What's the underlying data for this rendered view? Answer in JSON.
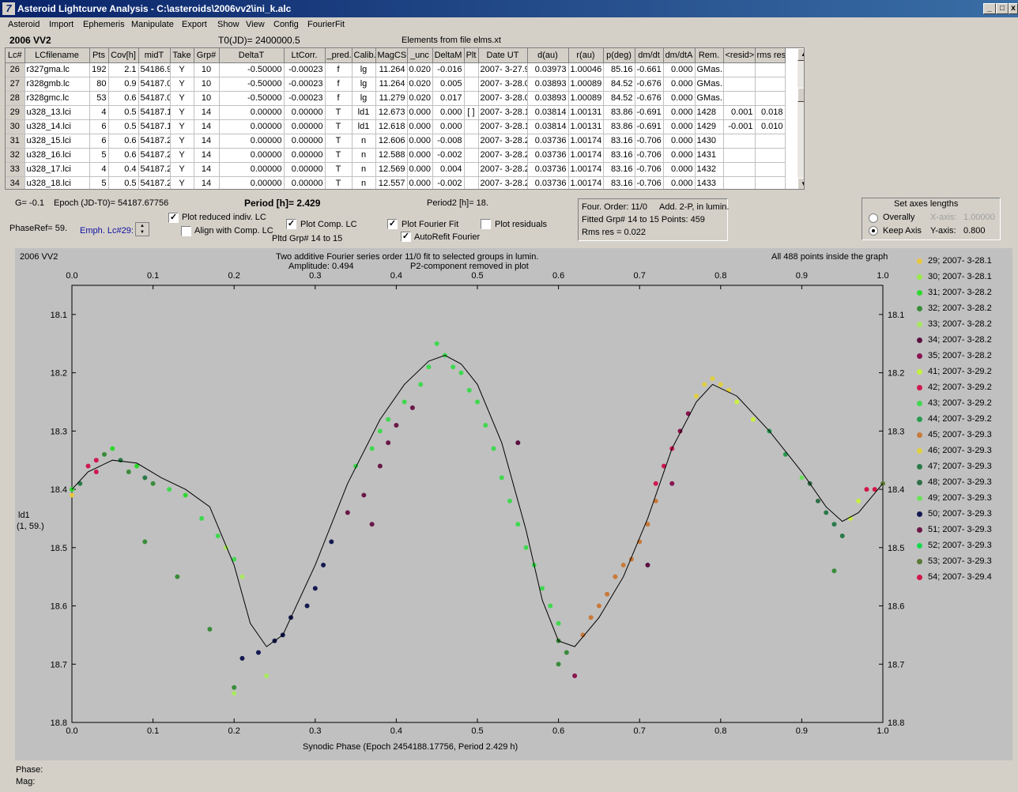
{
  "window": {
    "title": "Asteroid Lightcurve Analysis - C:\\asteroids\\2006vv2\\ini_k.alc",
    "controls": [
      "_",
      "□",
      "x"
    ]
  },
  "menu": [
    "Asteroid",
    "Import",
    "Ephemeris",
    "Manipulate",
    "Export",
    "Show",
    "View",
    "Config",
    "FourierFit"
  ],
  "header": {
    "object": "2006 VV2",
    "t0": "T0(JD)= 2400000.5",
    "elements": "Elements from file elms.xt"
  },
  "table": {
    "columns": [
      "Lc#",
      "LCfilename",
      "Pts",
      "Cov[h]",
      "midT",
      "Take",
      "Grp#",
      "DeltaT",
      "LtCorr.",
      "_pred.",
      "Calib.",
      "MagCS",
      "_unc",
      "DeltaM",
      "Plt",
      "Date UT",
      "d(au)",
      "r(au)",
      "p(deg)",
      "dm/dt",
      "dm/dtA",
      "Rem.",
      "<resid>",
      "rms res"
    ],
    "rows": [
      [
        "26",
        "r327gma.lc",
        "192",
        "2.1",
        "54186.9",
        "Y",
        "10",
        "-0.50000",
        "-0.00023",
        "f",
        "lg",
        "11.264",
        "0.020",
        "-0.016",
        "",
        "2007- 3-27.9",
        "0.03973",
        "1.00046",
        "85.16",
        "-0.661",
        "0.000",
        "GMas..",
        "",
        ""
      ],
      [
        "27",
        "r328gmb.lc",
        "80",
        "0.9",
        "54187.0",
        "Y",
        "10",
        "-0.50000",
        "-0.00023",
        "f",
        "lg",
        "11.264",
        "0.020",
        "0.005",
        "",
        "2007- 3-28.0",
        "0.03893",
        "1.00089",
        "84.52",
        "-0.676",
        "0.000",
        "GMas..",
        "",
        ""
      ],
      [
        "28",
        "r328gmc.lc",
        "53",
        "0.6",
        "54187.0",
        "Y",
        "10",
        "-0.50000",
        "-0.00023",
        "f",
        "lg",
        "11.279",
        "0.020",
        "0.017",
        "",
        "2007- 3-28.0",
        "0.03893",
        "1.00089",
        "84.52",
        "-0.676",
        "0.000",
        "GMas..",
        "",
        ""
      ],
      [
        "29",
        "u328_13.lci",
        "4",
        "0.5",
        "54187.1",
        "Y",
        "14",
        "0.00000",
        "0.00000",
        "T",
        "ld1",
        "12.673",
        "0.000",
        "0.000",
        "[ ]",
        "2007- 3-28.1",
        "0.03814",
        "1.00131",
        "83.86",
        "-0.691",
        "0.000",
        "1428",
        "0.001",
        "0.018"
      ],
      [
        "30",
        "u328_14.lci",
        "6",
        "0.5",
        "54187.1",
        "Y",
        "14",
        "0.00000",
        "0.00000",
        "T",
        "ld1",
        "12.618",
        "0.000",
        "0.000",
        "",
        "2007- 3-28.1",
        "0.03814",
        "1.00131",
        "83.86",
        "-0.691",
        "0.000",
        "1429",
        "-0.001",
        "0.010"
      ],
      [
        "31",
        "u328_15.lci",
        "6",
        "0.6",
        "54187.2",
        "Y",
        "14",
        "0.00000",
        "0.00000",
        "T",
        "n",
        "12.606",
        "0.000",
        "-0.008",
        "",
        "2007- 3-28.2",
        "0.03736",
        "1.00174",
        "83.16",
        "-0.706",
        "0.000",
        "1430",
        "",
        ""
      ],
      [
        "32",
        "u328_16.lci",
        "5",
        "0.6",
        "54187.2",
        "Y",
        "14",
        "0.00000",
        "0.00000",
        "T",
        "n",
        "12.588",
        "0.000",
        "-0.002",
        "",
        "2007- 3-28.2",
        "0.03736",
        "1.00174",
        "83.16",
        "-0.706",
        "0.000",
        "1431",
        "",
        ""
      ],
      [
        "33",
        "u328_17.lci",
        "4",
        "0.4",
        "54187.2",
        "Y",
        "14",
        "0.00000",
        "0.00000",
        "T",
        "n",
        "12.569",
        "0.000",
        "0.004",
        "",
        "2007- 3-28.2",
        "0.03736",
        "1.00174",
        "83.16",
        "-0.706",
        "0.000",
        "1432",
        "",
        ""
      ],
      [
        "34",
        "u328_18.lci",
        "5",
        "0.5",
        "54187.2",
        "Y",
        "14",
        "0.00000",
        "0.00000",
        "T",
        "n",
        "12.557",
        "0.000",
        "-0.002",
        "",
        "2007- 3-28.2",
        "0.03736",
        "1.00174",
        "83.16",
        "-0.706",
        "0.000",
        "1433",
        "",
        ""
      ]
    ]
  },
  "info": {
    "g": "G= -0.1",
    "epoch": "Epoch (JD-T0)= 54187.67756",
    "period": "Period [h]= 2.429",
    "period2": "Period2 [h]= 18.",
    "phaseref": "PhaseRef= 59.",
    "emph": "Emph. Lc#29:"
  },
  "checks": {
    "plot_reduced": "Plot reduced indiv. LC",
    "align": "Align with Comp. LC",
    "plot_comp": "Plot Comp. LC",
    "pltd_grp": "Pltd Grp#  14 to   15",
    "plot_fourier": "Plot Fourier Fit",
    "autorefit": "AutoRefit Fourier",
    "plot_resid": "Plot residuals"
  },
  "fourier_info": {
    "line1a": "Four. Order: 11/0",
    "line1b": "Add. 2-P, in lumin.",
    "line2": "Fitted Grp# 14 to 15 Points: 459",
    "line3": "Rms res      = 0.022"
  },
  "axes_panel": {
    "title": "Set axes lengths",
    "overally": "Overally",
    "keep": "Keep Axis",
    "xaxis_label": "X-axis:",
    "xaxis_val": "1.00000",
    "yaxis_label": "Y-axis:",
    "yaxis_val": "0.800"
  },
  "plot": {
    "name": "2006 VV2",
    "title1": "Two additive Fourier series order 11/0 fit to selected groups in lumin.",
    "amp": "Amplitude: 0.494",
    "p2": "P2-component removed in plot",
    "inside": "All 488 points inside the graph",
    "ylab1": "ld1",
    "ylab2": "(1, 59.)",
    "xlabel": "Synodic Phase (Epoch 2454188.17756, Period 2.429 h)"
  },
  "status": {
    "phase": "Phase:",
    "mag": "Mag:"
  },
  "chart_data": {
    "type": "scatter",
    "xlabel": "Synodic Phase (Epoch 2454188.17756, Period 2.429 h)",
    "ylabel": "ld1",
    "xlim": [
      0,
      1
    ],
    "ylim": [
      18.8,
      18.0
    ],
    "xticks": [
      0.0,
      0.1,
      0.2,
      0.3,
      0.4,
      0.5,
      0.6,
      0.7,
      0.8,
      0.9,
      1.0
    ],
    "yticks": [
      18.1,
      18.2,
      18.3,
      18.4,
      18.5,
      18.6,
      18.7,
      18.8
    ],
    "fit_curve": {
      "x": [
        0,
        0.02,
        0.05,
        0.08,
        0.11,
        0.14,
        0.17,
        0.2,
        0.22,
        0.24,
        0.26,
        0.3,
        0.34,
        0.38,
        0.41,
        0.44,
        0.46,
        0.48,
        0.5,
        0.53,
        0.56,
        0.58,
        0.6,
        0.62,
        0.65,
        0.68,
        0.71,
        0.74,
        0.77,
        0.79,
        0.82,
        0.86,
        0.9,
        0.93,
        0.95,
        0.97,
        1.0
      ],
      "y": [
        18.4,
        18.37,
        18.35,
        18.355,
        18.38,
        18.4,
        18.43,
        18.53,
        18.63,
        18.67,
        18.65,
        18.53,
        18.39,
        18.28,
        18.22,
        18.18,
        18.17,
        18.185,
        18.22,
        18.32,
        18.47,
        18.59,
        18.66,
        18.67,
        18.62,
        18.55,
        18.45,
        18.33,
        18.25,
        18.22,
        18.24,
        18.3,
        18.37,
        18.43,
        18.455,
        18.44,
        18.39
      ]
    },
    "series": [
      {
        "name": "29; 2007- 3-28.1",
        "color": "#e8c840"
      },
      {
        "name": "30; 2007- 3-28.1",
        "color": "#9ae84a"
      },
      {
        "name": "31; 2007- 3-28.2",
        "color": "#2ed82e"
      },
      {
        "name": "32; 2007- 3-28.2",
        "color": "#3a8c3a"
      },
      {
        "name": "33; 2007- 3-28.2",
        "color": "#a8e860"
      },
      {
        "name": "34; 2007- 3-28.2",
        "color": "#5a1040"
      },
      {
        "name": "35; 2007- 3-28.2",
        "color": "#8a1450"
      },
      {
        "name": "41; 2007- 3-29.2",
        "color": "#c8f040"
      },
      {
        "name": "42; 2007- 3-29.2",
        "color": "#d01850"
      },
      {
        "name": "43; 2007- 3-29.2",
        "color": "#40d850"
      },
      {
        "name": "44; 2007- 3-29.2",
        "color": "#2a9a50"
      },
      {
        "name": "45; 2007- 3-29.3",
        "color": "#c87a3a"
      },
      {
        "name": "46; 2007- 3-29.3",
        "color": "#e0d040"
      },
      {
        "name": "47; 2007- 3-29.3",
        "color": "#2a7a4a"
      },
      {
        "name": "48; 2007- 3-29.3",
        "color": "#307048"
      },
      {
        "name": "49; 2007- 3-29.3",
        "color": "#70e060"
      },
      {
        "name": "50; 2007- 3-29.3",
        "color": "#141a50"
      },
      {
        "name": "51; 2007- 3-29.3",
        "color": "#6a1848"
      },
      {
        "name": "52; 2007- 3-29.3",
        "color": "#18d850"
      },
      {
        "name": "53; 2007- 3-29.3",
        "color": "#5a7a38"
      },
      {
        "name": "54; 2007- 3-29.4",
        "color": "#d01848"
      }
    ],
    "points": [
      [
        0.0,
        18.4,
        2
      ],
      [
        0.01,
        18.39,
        13
      ],
      [
        0.02,
        18.36,
        8
      ],
      [
        0.03,
        18.35,
        8
      ],
      [
        0.04,
        18.34,
        3
      ],
      [
        0.05,
        18.33,
        2
      ],
      [
        0.06,
        18.35,
        13
      ],
      [
        0.07,
        18.37,
        3
      ],
      [
        0.08,
        18.36,
        2
      ],
      [
        0.09,
        18.38,
        13
      ],
      [
        0.1,
        18.39,
        3
      ],
      [
        0.12,
        18.4,
        9
      ],
      [
        0.14,
        18.41,
        2
      ],
      [
        0.16,
        18.45,
        9
      ],
      [
        0.18,
        18.48,
        9
      ],
      [
        0.19,
        18.5,
        4
      ],
      [
        0.2,
        18.52,
        9
      ],
      [
        0.21,
        18.55,
        4
      ],
      [
        0.0,
        18.41,
        0
      ],
      [
        0.03,
        18.37,
        8
      ],
      [
        0.09,
        18.49,
        3
      ],
      [
        0.13,
        18.55,
        3
      ],
      [
        0.17,
        18.64,
        3
      ],
      [
        0.2,
        18.74,
        3
      ],
      [
        0.2,
        18.75,
        4
      ],
      [
        0.24,
        18.72,
        4
      ],
      [
        0.26,
        18.65,
        16
      ],
      [
        0.21,
        18.69,
        16
      ],
      [
        0.23,
        18.68,
        16
      ],
      [
        0.25,
        18.66,
        16
      ],
      [
        0.27,
        18.62,
        16
      ],
      [
        0.29,
        18.6,
        16
      ],
      [
        0.3,
        18.57,
        16
      ],
      [
        0.31,
        18.53,
        16
      ],
      [
        0.32,
        18.49,
        16
      ],
      [
        0.34,
        18.44,
        17
      ],
      [
        0.36,
        18.41,
        17
      ],
      [
        0.37,
        18.46,
        17
      ],
      [
        0.38,
        18.36,
        17
      ],
      [
        0.39,
        18.32,
        17
      ],
      [
        0.4,
        18.29,
        17
      ],
      [
        0.42,
        18.26,
        17
      ],
      [
        0.35,
        18.36,
        9
      ],
      [
        0.37,
        18.33,
        9
      ],
      [
        0.38,
        18.3,
        9
      ],
      [
        0.39,
        18.28,
        9
      ],
      [
        0.41,
        18.25,
        9
      ],
      [
        0.43,
        18.22,
        9
      ],
      [
        0.44,
        18.19,
        9
      ],
      [
        0.45,
        18.15,
        9
      ],
      [
        0.46,
        18.17,
        9
      ],
      [
        0.47,
        18.19,
        9
      ],
      [
        0.48,
        18.2,
        9
      ],
      [
        0.49,
        18.23,
        9
      ],
      [
        0.5,
        18.25,
        9
      ],
      [
        0.51,
        18.29,
        9
      ],
      [
        0.52,
        18.33,
        9
      ],
      [
        0.53,
        18.38,
        9
      ],
      [
        0.54,
        18.42,
        9
      ],
      [
        0.55,
        18.46,
        9
      ],
      [
        0.56,
        18.5,
        9
      ],
      [
        0.57,
        18.53,
        9
      ],
      [
        0.58,
        18.57,
        9
      ],
      [
        0.59,
        18.6,
        9
      ],
      [
        0.6,
        18.63,
        9
      ],
      [
        0.6,
        18.66,
        3
      ],
      [
        0.61,
        18.68,
        3
      ],
      [
        0.62,
        18.72,
        6
      ],
      [
        0.6,
        18.7,
        3
      ],
      [
        0.63,
        18.65,
        11
      ],
      [
        0.64,
        18.62,
        11
      ],
      [
        0.65,
        18.6,
        11
      ],
      [
        0.66,
        18.58,
        11
      ],
      [
        0.67,
        18.55,
        11
      ],
      [
        0.68,
        18.53,
        11
      ],
      [
        0.69,
        18.52,
        11
      ],
      [
        0.7,
        18.49,
        11
      ],
      [
        0.71,
        18.46,
        11
      ],
      [
        0.72,
        18.42,
        11
      ],
      [
        0.72,
        18.39,
        8
      ],
      [
        0.73,
        18.36,
        8
      ],
      [
        0.74,
        18.33,
        8
      ],
      [
        0.75,
        18.3,
        6
      ],
      [
        0.76,
        18.27,
        6
      ],
      [
        0.77,
        18.24,
        12
      ],
      [
        0.78,
        18.22,
        12
      ],
      [
        0.79,
        18.21,
        12
      ],
      [
        0.8,
        18.22,
        12
      ],
      [
        0.81,
        18.23,
        12
      ],
      [
        0.82,
        18.25,
        7
      ],
      [
        0.84,
        18.28,
        7
      ],
      [
        0.86,
        18.3,
        10
      ],
      [
        0.88,
        18.34,
        10
      ],
      [
        0.9,
        18.38,
        15
      ],
      [
        0.91,
        18.39,
        14
      ],
      [
        0.92,
        18.42,
        14
      ],
      [
        0.93,
        18.44,
        13
      ],
      [
        0.94,
        18.46,
        13
      ],
      [
        0.95,
        18.48,
        13
      ],
      [
        0.96,
        18.45,
        7
      ],
      [
        0.97,
        18.42,
        7
      ],
      [
        0.98,
        18.4,
        20
      ],
      [
        0.99,
        18.4,
        20
      ],
      [
        1.0,
        18.39,
        19
      ],
      [
        0.94,
        18.54,
        3
      ],
      [
        0.71,
        18.53,
        5
      ],
      [
        0.74,
        18.39,
        6
      ],
      [
        0.55,
        18.32,
        5
      ]
    ]
  }
}
